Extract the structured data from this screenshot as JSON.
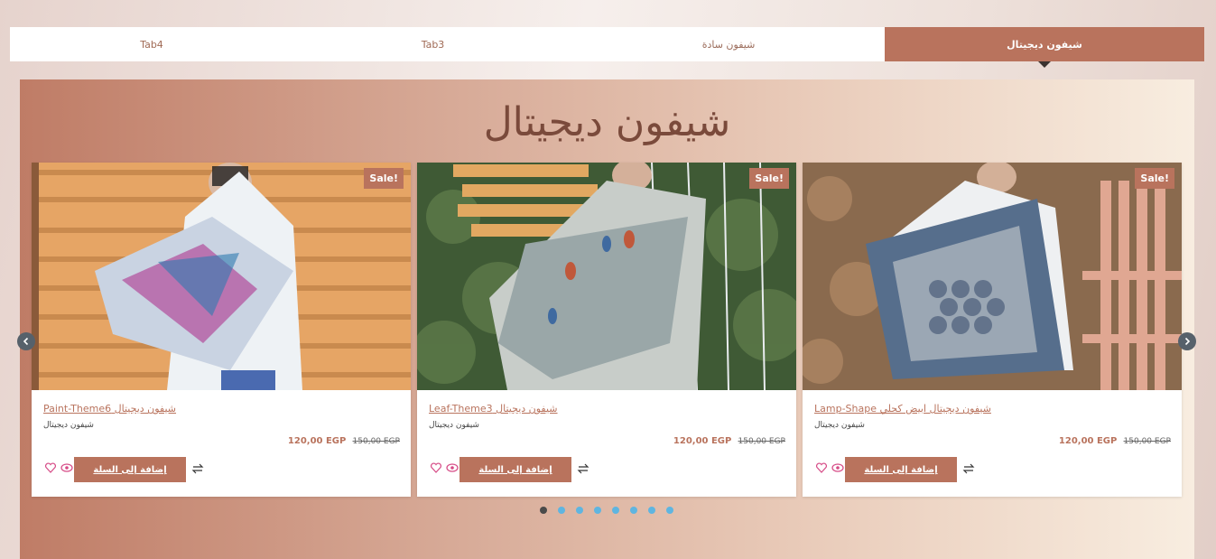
{
  "tabs": [
    {
      "label": "شيفون ديجيتال",
      "active": true
    },
    {
      "label": "شيفون سادة",
      "active": false
    },
    {
      "label": "Tab3",
      "active": false
    },
    {
      "label": "Tab4",
      "active": false
    }
  ],
  "section_title": "شيفون ديجيتال",
  "products": [
    {
      "sale": "Sale!",
      "title": "شيفون ديجيتال Paint-Theme6",
      "category": "شيفون ديجيتال",
      "price_old": "150,00 EGP",
      "price_current": "120,00 EGP",
      "add_to_cart": "إضافة إلى السلة"
    },
    {
      "sale": "Sale!",
      "title": "شيفون ديجيتال Leaf-Theme3",
      "category": "شيفون ديجيتال",
      "price_old": "150,00 EGP",
      "price_current": "120,00 EGP",
      "add_to_cart": "إضافة إلى السلة"
    },
    {
      "sale": "Sale!",
      "title": "شيفون ديجيتال ابيض كحلي Lamp-Shape",
      "category": "شيفون ديجيتال",
      "price_old": "150,00 EGP",
      "price_current": "120,00 EGP",
      "add_to_cart": "إضافة إلى السلة"
    }
  ],
  "carousel": {
    "dot_count": 8,
    "active_dot": 0
  },
  "colors": {
    "accent": "#b9735d",
    "title": "#7a4a3b",
    "dot": "#5fb5e0",
    "heart": "#d64a86"
  }
}
